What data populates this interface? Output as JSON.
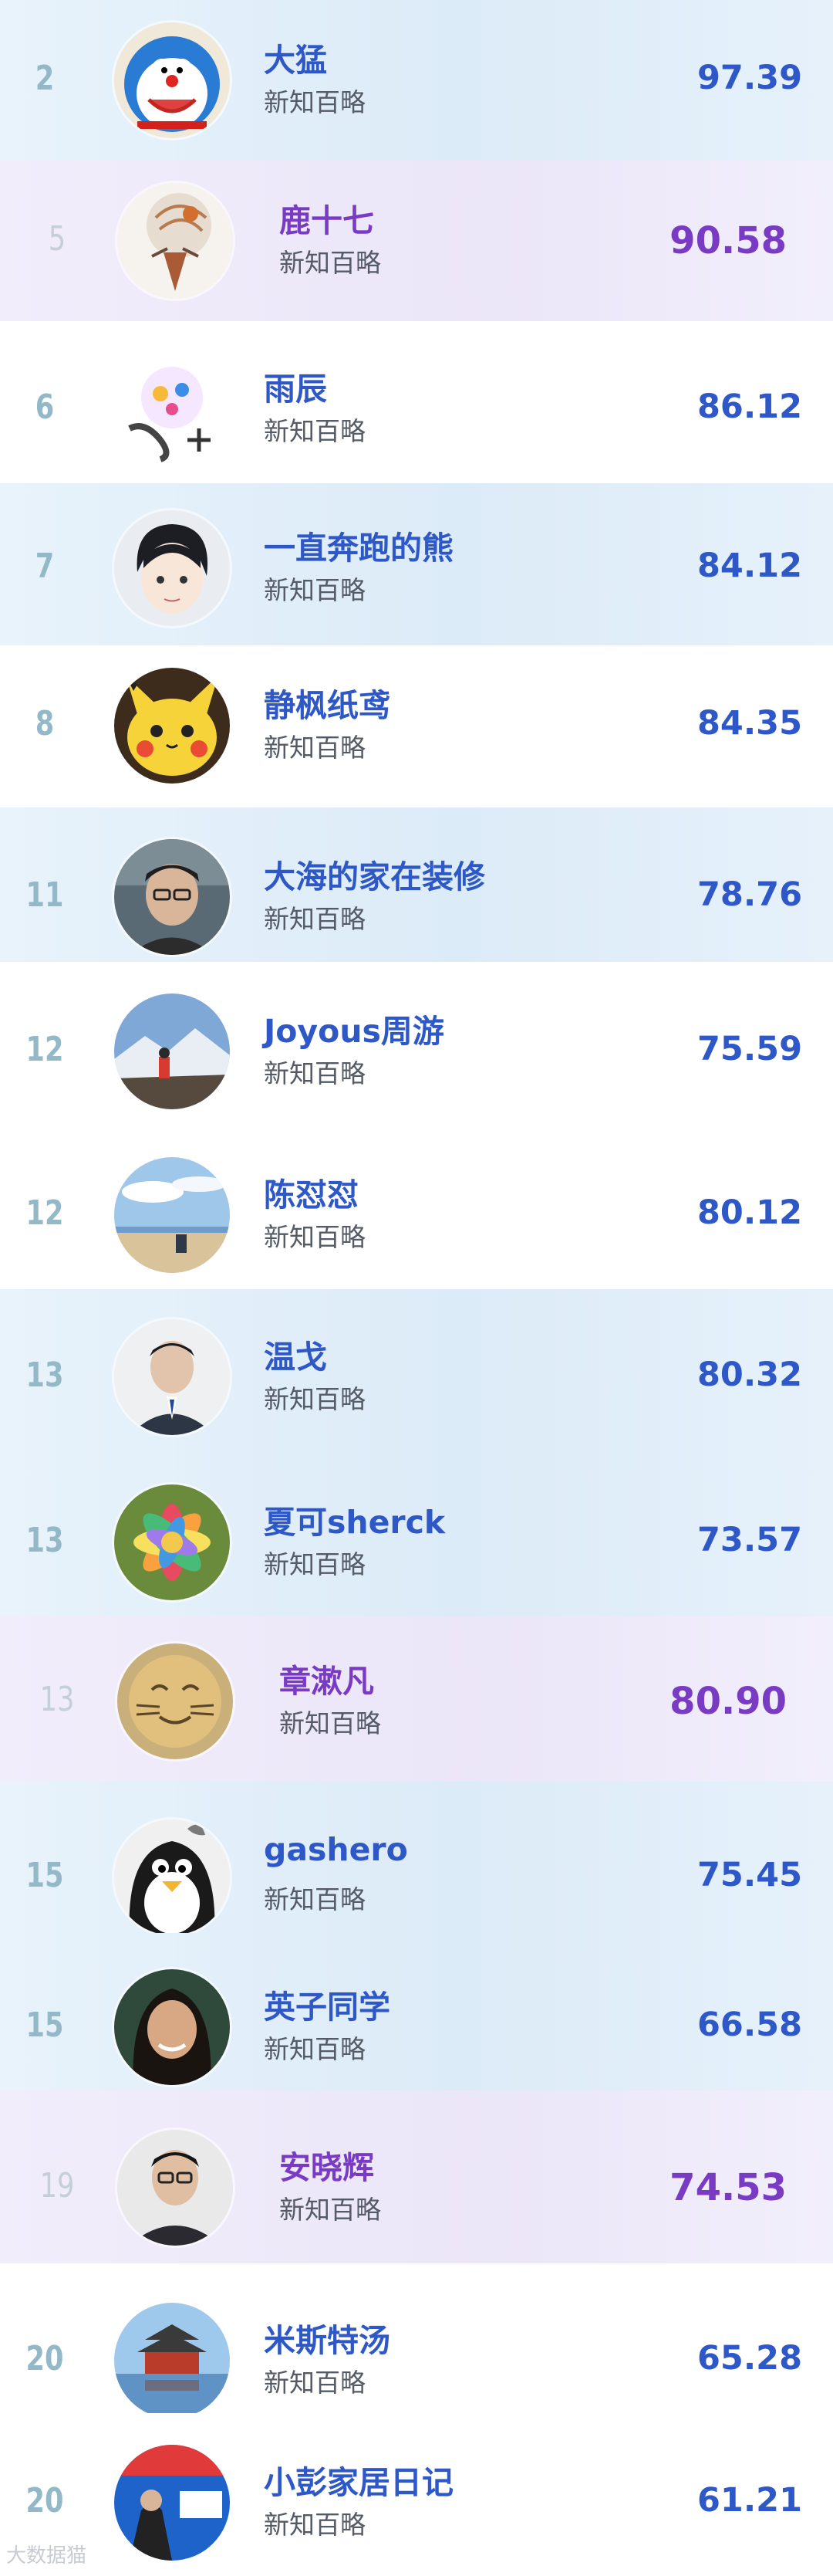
{
  "rows": [
    {
      "rank": "2",
      "name": "大猛",
      "sub": "新知百略",
      "score": "97.39",
      "style": "blue",
      "avatar": "cartoon-cat-avatar"
    },
    {
      "rank": "5",
      "name": "鹿十七",
      "sub": "新知百略",
      "score": "90.58",
      "style": "purple",
      "avatar": "deer-art-avatar"
    },
    {
      "rank": "6",
      "name": "雨辰",
      "sub": "新知百略",
      "score": "86.12",
      "style": "white",
      "avatar": "graffiti-avatar"
    },
    {
      "rank": "7",
      "name": "一直奔跑的熊",
      "sub": "新知百略",
      "score": "84.12",
      "style": "blue",
      "avatar": "anime-boy-avatar"
    },
    {
      "rank": "8",
      "name": "静枫纸鸢",
      "sub": "新知百略",
      "score": "84.35",
      "style": "white",
      "avatar": "pikachu-avatar"
    },
    {
      "rank": "11",
      "name": "大海的家在装修",
      "sub": "新知百略",
      "score": "78.76",
      "style": "blue",
      "avatar": "man-glasses-avatar"
    },
    {
      "rank": "12",
      "name": "Joyous周游",
      "sub": "新知百略",
      "score": "75.59",
      "style": "white",
      "avatar": "mountain-hiker-avatar"
    },
    {
      "rank": "12",
      "name": "陈怼怼",
      "sub": "新知百略",
      "score": "80.12",
      "style": "white",
      "avatar": "beach-sky-avatar"
    },
    {
      "rank": "13",
      "name": "温戈",
      "sub": "新知百略",
      "score": "80.32",
      "style": "blue",
      "avatar": "man-suit-avatar"
    },
    {
      "rank": "13",
      "name": "夏可sherck",
      "sub": "新知百略",
      "score": "73.57",
      "style": "blue",
      "avatar": "rainbow-flower-avatar"
    },
    {
      "rank": "13",
      "name": "章漱凡",
      "sub": "新知百略",
      "score": "80.90",
      "style": "purple",
      "avatar": "cat-face-avatar"
    },
    {
      "rank": "15",
      "name": "gashero",
      "sub": "新知百略",
      "score": "75.45",
      "style": "blue",
      "avatar": "penguin-avatar"
    },
    {
      "rank": "15",
      "name": "英子同学",
      "sub": "新知百略",
      "score": "66.58",
      "style": "blue",
      "avatar": "woman-smile-avatar"
    },
    {
      "rank": "19",
      "name": "安晓辉",
      "sub": "新知百略",
      "score": "74.53",
      "style": "purple",
      "avatar": "man-portrait-avatar"
    },
    {
      "rank": "20",
      "name": "米斯特汤",
      "sub": "新知百略",
      "score": "65.28",
      "style": "white",
      "avatar": "pavilion-lake-avatar"
    },
    {
      "rank": "20",
      "name": "小彭家居日记",
      "sub": "新知百略",
      "score": "61.21",
      "style": "white",
      "avatar": "zhihu-booth-avatar"
    }
  ],
  "watermark": "大数据猫"
}
